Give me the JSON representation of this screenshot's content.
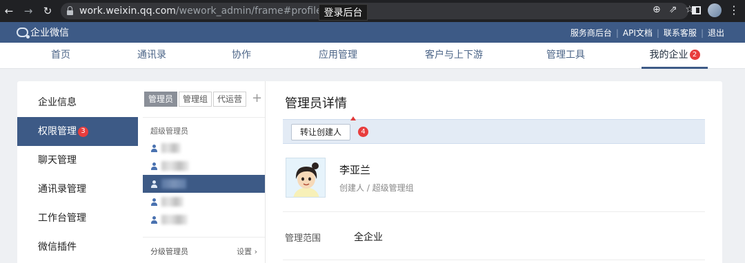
{
  "browser": {
    "url_domain": "work.weixin.qq.com",
    "url_path": "/wework_admin/frame#profile/role",
    "url_badge": "1",
    "tooltip": "登录后台"
  },
  "header": {
    "logo_text": "企业微信",
    "links": [
      "服务商后台",
      "API文档",
      "联系客服",
      "退出"
    ]
  },
  "nav": {
    "items": [
      "首页",
      "通讯录",
      "协作",
      "应用管理",
      "客户与上下游",
      "管理工具",
      "我的企业"
    ],
    "active_badge": "2"
  },
  "sidebar": {
    "items": [
      "企业信息",
      "权限管理",
      "聊天管理",
      "通讯录管理",
      "工作台管理",
      "微信插件"
    ],
    "active_badge": "3"
  },
  "admin_list": {
    "tabs": [
      "管理员",
      "管理组",
      "代运营"
    ],
    "add_label": "+",
    "group_title": "超级管理员",
    "sub_admin_label": "分级管理员",
    "settings_label": "设置"
  },
  "detail": {
    "title": "管理员详情",
    "transfer_button": "转让创建人",
    "transfer_badge": "4",
    "name": "李亚兰",
    "role": "创建人 / 超级管理组",
    "scope_label": "管理范围",
    "scope_value": "全企业"
  },
  "colors": {
    "header_bg": "#3d5a86",
    "badge_red": "#e83d3d"
  }
}
